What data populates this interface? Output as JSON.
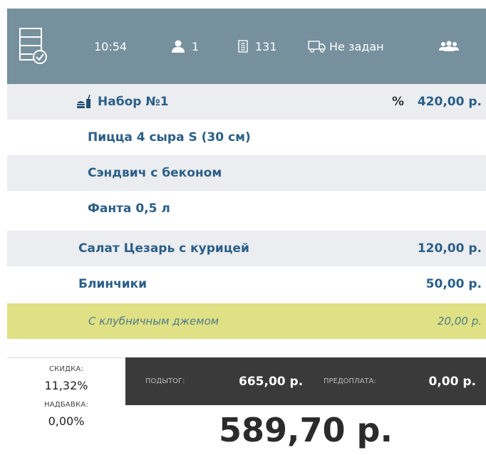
{
  "header": {
    "time": "10:54",
    "guests": "1",
    "table": "131",
    "delivery": "Не задан"
  },
  "items": [
    {
      "name": "Набор №1",
      "percent": "%",
      "price": "420,00 р."
    },
    {
      "name": "Пицца 4 сыра S (30 см)"
    },
    {
      "name": "Сэндвич с беконом"
    },
    {
      "name": "Фанта 0,5 л"
    },
    {
      "name": "Салат Цезарь с курицей",
      "price": "120,00 р."
    },
    {
      "name": "Блинчики",
      "price": "50,00 р."
    },
    {
      "name": "С клубничным джемом",
      "price": "20,00 р."
    }
  ],
  "footer": {
    "discount_label": "СКИДКА:",
    "discount_value": "11,32%",
    "markup_label": "НАДБАВКА:",
    "markup_value": "0,00%",
    "subtotal_label": "ПОДЫТОГ:",
    "subtotal_value": "665,00 р.",
    "prepay_label": "ПРЕДОПЛАТА:",
    "prepay_value": "0,00 р.",
    "total": "589,70 р."
  },
  "colors": {
    "header_bg": "#76909e",
    "row_grey": "#ebedf0",
    "modifier_bg": "#dfe184",
    "text_blue": "#2b5f88",
    "footer_dark": "#3a3a3a"
  }
}
